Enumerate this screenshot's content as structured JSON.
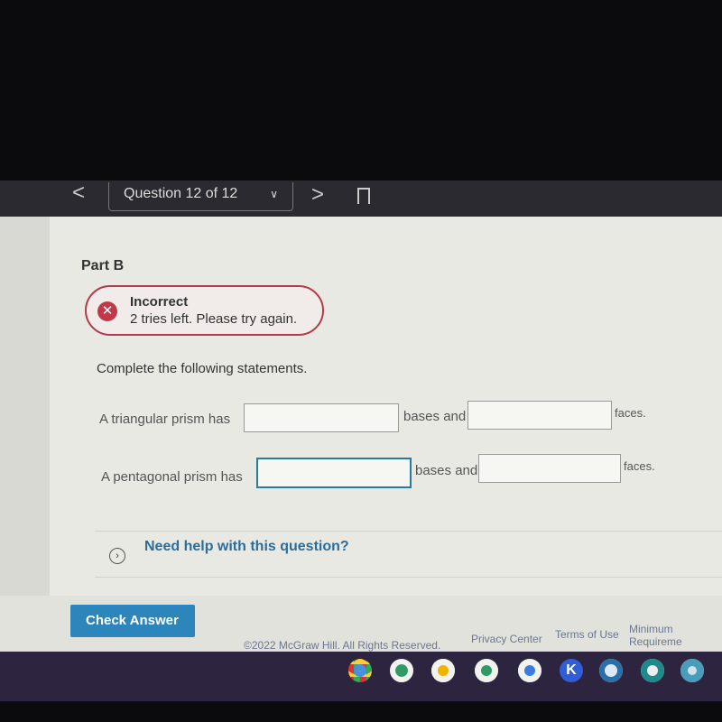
{
  "nav": {
    "prev": "<",
    "question_selector": "Question 12 of 12",
    "next": ">"
  },
  "part": "Part B",
  "feedback": {
    "status": "Incorrect",
    "message": "2 tries left. Please try again.",
    "icon": "x-icon",
    "color": "#c0394a"
  },
  "instructions": "Complete the following statements.",
  "statements": [
    {
      "prefix": "A triangular prism has",
      "middle": "bases and",
      "suffix": "faces.",
      "input1": "",
      "input2": ""
    },
    {
      "prefix": "A pentagonal prism has",
      "middle": "bases and",
      "suffix": "faces.",
      "input1": "",
      "input2": ""
    }
  ],
  "help": {
    "label": "Need help with this question?"
  },
  "check_answer": "Check Answer",
  "footer": {
    "copyright": "©2022 McGraw Hill. All Rights Reserved.",
    "privacy": "Privacy Center",
    "terms": "Terms of Use",
    "requirements": "Minimum Requireme"
  },
  "shelf_apps": [
    "chrome",
    "google-classroom",
    "google-slides",
    "google-sheets",
    "google-docs",
    "kami",
    "app-7",
    "calculator",
    "app-9"
  ]
}
